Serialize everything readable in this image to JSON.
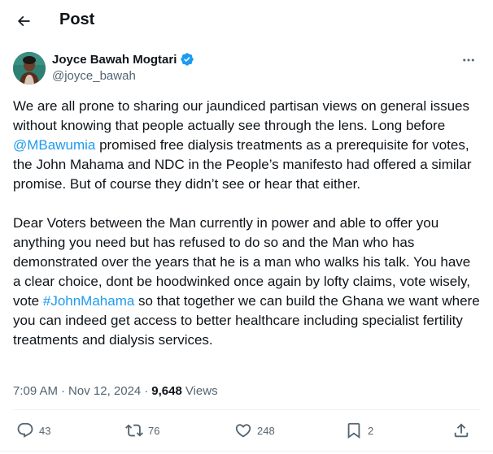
{
  "header": {
    "title": "Post",
    "back_icon": "arrow-left-icon"
  },
  "author": {
    "display_name": "Joyce Bawah Mogtari",
    "handle": "@joyce_bawah",
    "verified": true,
    "verified_color": "#1d9bf0",
    "more_icon": "more-horizontal-icon"
  },
  "post": {
    "paragraph1": {
      "part1": "We are all prone to sharing our jaundiced partisan views on general issues without knowing that people actually see through the lens. Long before ",
      "mention": "@MBawumia",
      "part2": " promised free dialysis treatments as a prerequisite for votes, the John Mahama and NDC in the People’s manifesto had offered a similar promise. But of course they didn’t see or hear that either."
    },
    "paragraph2": {
      "part1": "Dear Voters between the Man currently in power and able to offer you anything you need but has refused to do so and the Man who has demonstrated over the years that he is a man who walks his talk. You have a clear choice, dont be hoodwinked once again by lofty claims, vote wisely, vote ",
      "hashtag": "#JohnMahama",
      "part2": " so that together we can build the Ghana we want where you can indeed get access to better healthcare including specialist fertility treatments and dialysis services."
    },
    "link_color": "#1d9bf0"
  },
  "meta": {
    "time": "7:09 AM",
    "separator": "·",
    "date": "Nov 12, 2024",
    "separator2": "·",
    "views_count": "9,648",
    "views_label": "Views"
  },
  "actions": {
    "replies": "43",
    "reposts": "76",
    "likes": "248",
    "bookmarks": "2",
    "icons": [
      "reply-icon",
      "repost-icon",
      "like-icon",
      "bookmark-icon",
      "share-icon"
    ]
  }
}
